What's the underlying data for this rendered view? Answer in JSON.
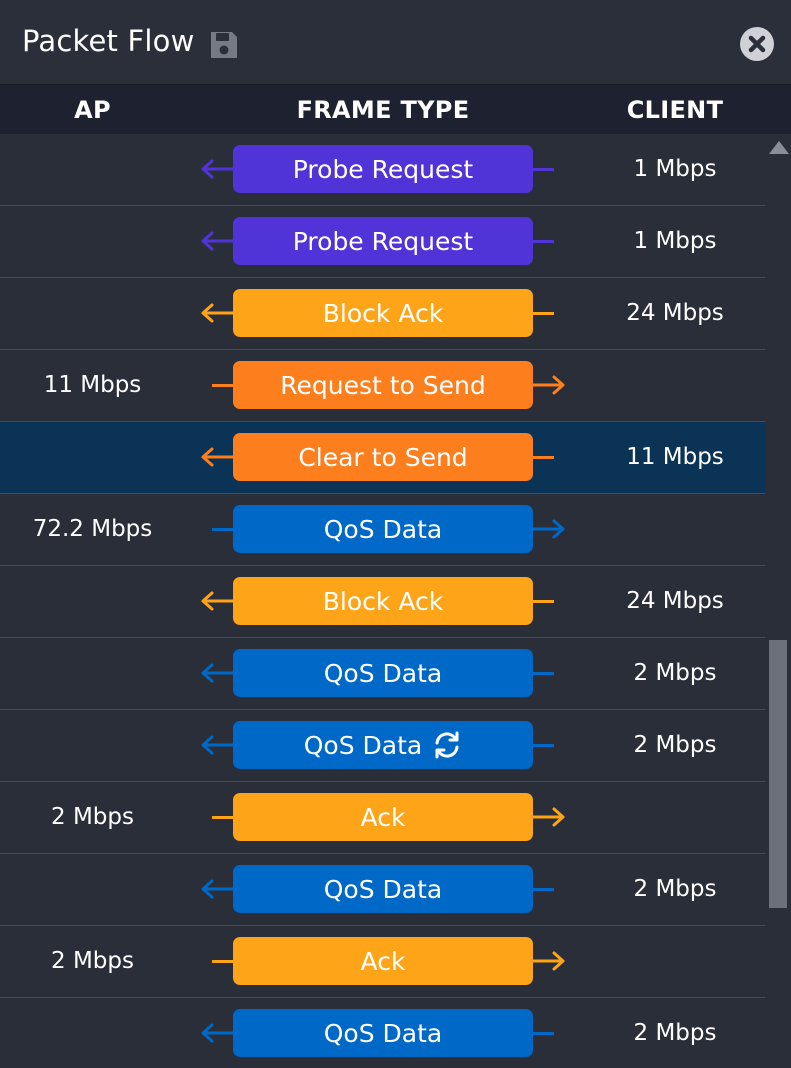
{
  "window": {
    "title": "Packet Flow",
    "save_icon": "floppy-disk-icon",
    "close_icon": "close-circle-icon"
  },
  "columns": {
    "ap": "AP",
    "frame_type": "FRAME TYPE",
    "client": "CLIENT"
  },
  "colors": {
    "probe": "#5034d8",
    "block_ack": "#fda419",
    "rts_cts": "#fd7e1c",
    "qos": "#0068c6",
    "ack": "#fda419",
    "selected_row": "#0b3356"
  },
  "rows": [
    {
      "frame": "Probe Request",
      "direction": "to-ap",
      "ap_rate": "",
      "client_rate": "1 Mbps",
      "color": "#5034d8"
    },
    {
      "frame": "Probe Request",
      "direction": "to-ap",
      "ap_rate": "",
      "client_rate": "1 Mbps",
      "color": "#5034d8"
    },
    {
      "frame": "Block Ack",
      "direction": "to-ap",
      "ap_rate": "",
      "client_rate": "24 Mbps",
      "color": "#fda419"
    },
    {
      "frame": "Request to Send",
      "direction": "to-client",
      "ap_rate": "11 Mbps",
      "client_rate": "",
      "color": "#fd7e1c"
    },
    {
      "frame": "Clear to Send",
      "direction": "to-ap",
      "ap_rate": "",
      "client_rate": "11 Mbps",
      "color": "#fd7e1c",
      "selected": true
    },
    {
      "frame": "QoS Data",
      "direction": "to-client",
      "ap_rate": "72.2 Mbps",
      "client_rate": "",
      "color": "#0068c6"
    },
    {
      "frame": "Block Ack",
      "direction": "to-ap",
      "ap_rate": "",
      "client_rate": "24 Mbps",
      "color": "#fda419"
    },
    {
      "frame": "QoS Data",
      "direction": "to-ap",
      "ap_rate": "",
      "client_rate": "2 Mbps",
      "color": "#0068c6"
    },
    {
      "frame": "QoS Data",
      "direction": "to-ap",
      "ap_rate": "",
      "client_rate": "2 Mbps",
      "color": "#0068c6",
      "retry_icon": "refresh-icon"
    },
    {
      "frame": "Ack",
      "direction": "to-client",
      "ap_rate": "2 Mbps",
      "client_rate": "",
      "color": "#fda419"
    },
    {
      "frame": "QoS Data",
      "direction": "to-ap",
      "ap_rate": "",
      "client_rate": "2 Mbps",
      "color": "#0068c6"
    },
    {
      "frame": "Ack",
      "direction": "to-client",
      "ap_rate": "2 Mbps",
      "client_rate": "",
      "color": "#fda419"
    },
    {
      "frame": "QoS Data",
      "direction": "to-ap",
      "ap_rate": "",
      "client_rate": "2 Mbps",
      "color": "#0068c6"
    }
  ]
}
